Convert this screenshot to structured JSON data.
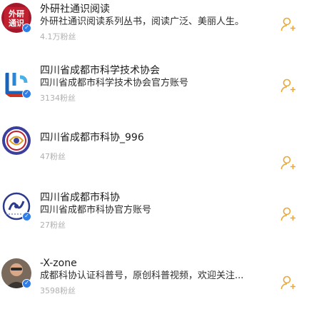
{
  "results": [
    {
      "name": "外研社通识阅读",
      "bio": "外研社通识阅读系列丛书，阅读广泛、美丽人生。",
      "fans": "4.1万粉丝",
      "avatar": "外研通识",
      "verified": true
    },
    {
      "name": "四川省成都市科学技术协会",
      "bio": "四川省成都市科学技术协会官方账号",
      "fans": "3134粉丝",
      "avatar": "科协",
      "verified": true
    },
    {
      "name": "四川省成都市科协_996",
      "bio": "",
      "fans": "47粉丝",
      "avatar": "科协徽",
      "verified": false
    },
    {
      "name": "四川省成都市科协",
      "bio": "四川省成都市科协官方账号",
      "fans": "27粉丝",
      "avatar": "科协会",
      "verified": true
    },
    {
      "name": "-X-zone",
      "bio": "成都科协认证科普号，原创科普视频，欢迎关注...",
      "fans": "3598粉丝",
      "avatar": "人像",
      "verified": true
    }
  ],
  "icons": {
    "follow": "follow-user-icon",
    "verified": "verified-badge-icon"
  },
  "colors": {
    "accent": "#e8a83a",
    "verified": "#2f7de8",
    "fans_text": "#b0b0b0"
  }
}
